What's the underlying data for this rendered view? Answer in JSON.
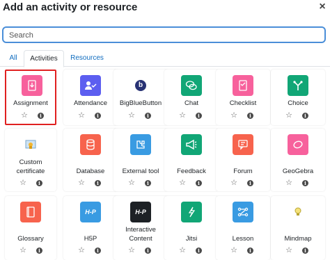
{
  "dialog": {
    "title": "Add an activity or resource",
    "close_glyph": "×"
  },
  "search": {
    "placeholder": "Search",
    "value": ""
  },
  "tabs": [
    {
      "label": "All",
      "active": false
    },
    {
      "label": "Activities",
      "active": true
    },
    {
      "label": "Resources",
      "active": false
    }
  ],
  "tiles": [
    {
      "label": "Assignment",
      "icon": "assignment-icon",
      "color": "#f7619c",
      "selected": true
    },
    {
      "label": "Attendance",
      "icon": "attendance-icon",
      "color": "#5c5ef0"
    },
    {
      "label": "BigBlueButton",
      "icon": "bigbluebutton-icon",
      "color": "#ffffff",
      "glyph": "b"
    },
    {
      "label": "Chat",
      "icon": "chat-icon",
      "color": "#11a676"
    },
    {
      "label": "Checklist",
      "icon": "checklist-icon",
      "color": "#f7619c"
    },
    {
      "label": "Choice",
      "icon": "choice-icon",
      "color": "#11a676"
    },
    {
      "label": "Custom certificate",
      "icon": "certificate-icon",
      "color": "#ffffff"
    },
    {
      "label": "Database",
      "icon": "database-icon",
      "color": "#f7634d"
    },
    {
      "label": "External tool",
      "icon": "external-tool-icon",
      "color": "#399be2"
    },
    {
      "label": "Feedback",
      "icon": "feedback-icon",
      "color": "#11a676"
    },
    {
      "label": "Forum",
      "icon": "forum-icon",
      "color": "#f7634d"
    },
    {
      "label": "GeoGebra",
      "icon": "geogebra-icon",
      "color": "#f7619c"
    },
    {
      "label": "Glossary",
      "icon": "glossary-icon",
      "color": "#f7634d"
    },
    {
      "label": "H5P",
      "icon": "h5p-icon",
      "color": "#399be2",
      "glyph": "H-P"
    },
    {
      "label": "Interactive Content",
      "icon": "interactive-content-icon",
      "color": "#1d2125",
      "glyph": "H-P"
    },
    {
      "label": "Jitsi",
      "icon": "jitsi-icon",
      "color": "#11a676"
    },
    {
      "label": "Lesson",
      "icon": "lesson-icon",
      "color": "#399be2"
    },
    {
      "label": "Mindmap",
      "icon": "mindmap-icon",
      "color": "#ffffff"
    }
  ],
  "colors": {
    "accent": "#0f6cbf",
    "selection": "#e02020",
    "focus": "#4a8ed8"
  }
}
